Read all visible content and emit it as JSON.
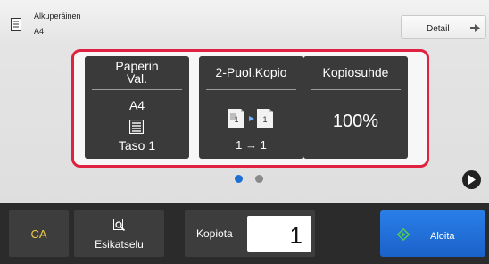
{
  "original": {
    "title": "Alkuperäinen",
    "size": "A4",
    "icon": "document-icon"
  },
  "detail_button": {
    "label": "Detail",
    "icon": "arrow-right-icon"
  },
  "tiles": {
    "paper": {
      "header_line1": "Paperin",
      "header_line2": "Val.",
      "value": "A4",
      "icon": "paper-tray-icon",
      "footer": "Taso 1"
    },
    "duplex": {
      "header": "2-Puol.Kopio",
      "icon": "duplex-copy-icon",
      "footer": "1 → 1"
    },
    "ratio": {
      "header": "Kopiosuhde",
      "value": "100%"
    }
  },
  "pager": {
    "current_page": 1,
    "total_pages": 2,
    "next_icon": "next-page-icon"
  },
  "bottom": {
    "ca_label": "CA",
    "preview_label": "Esikatselu",
    "preview_icon": "preview-magnifier-icon",
    "copies_label": "Kopiota",
    "copies_value": "1",
    "start_label": "Aloita",
    "start_icon": "start-diamond-icon"
  },
  "colors": {
    "highlight_border": "#e0213f",
    "tile_bg": "#3a3a3a",
    "start_blue": "#1f6fd1",
    "ca_text": "#f0c94a",
    "start_icon_green": "#57d04b"
  }
}
